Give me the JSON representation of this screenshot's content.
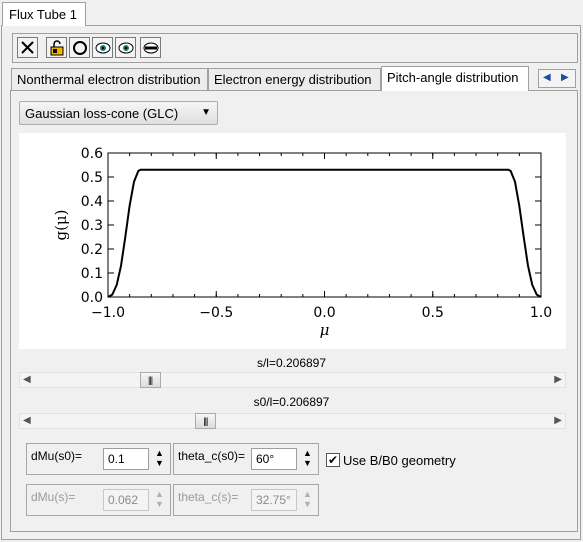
{
  "window": {
    "tab_title": "Flux Tube 1"
  },
  "toolbar": {
    "buttons": [
      {
        "icon": "close-x-icon"
      },
      {
        "icon": "lock-icon"
      },
      {
        "icon": "circle-icon"
      },
      {
        "icon": "eye-icon"
      },
      {
        "icon": "eye-icon"
      },
      {
        "icon": "eye-slash-icon"
      }
    ]
  },
  "tabs": [
    {
      "label": "Nonthermal electron distribution",
      "active": false
    },
    {
      "label": "Electron energy distribution",
      "active": false
    },
    {
      "label": "Pitch-angle distribution",
      "active": true
    }
  ],
  "distribution_select": {
    "value": "Gaussian loss-cone (GLC)"
  },
  "chart_data": {
    "type": "line",
    "xlabel": "μ",
    "ylabel": "g(μ)",
    "xlim": [
      -1.0,
      1.0
    ],
    "ylim": [
      0.0,
      0.6
    ],
    "xticks": [
      "−1.0",
      "−0.5",
      "0.0",
      "0.5",
      "1.0"
    ],
    "yticks": [
      "0.0",
      "0.1",
      "0.2",
      "0.3",
      "0.4",
      "0.5",
      "0.6"
    ],
    "series": [
      {
        "x": [
          -1.0,
          -0.98,
          -0.96,
          -0.94,
          -0.92,
          -0.9,
          -0.88,
          -0.86,
          -0.85,
          -0.5,
          0.0,
          0.5,
          0.85,
          0.86,
          0.88,
          0.9,
          0.92,
          0.94,
          0.96,
          0.98,
          1.0
        ],
        "y": [
          0.0,
          0.01,
          0.05,
          0.13,
          0.25,
          0.38,
          0.48,
          0.525,
          0.53,
          0.53,
          0.53,
          0.53,
          0.53,
          0.525,
          0.48,
          0.38,
          0.25,
          0.13,
          0.05,
          0.01,
          0.0
        ]
      }
    ]
  },
  "slider_s": {
    "label": "s/l=0.206897",
    "value": 0.206897
  },
  "slider_s0": {
    "label": "s0/l=0.206897",
    "value": 0.206897
  },
  "fields": {
    "dmu_s0": {
      "label": "dMu(s0)=",
      "value": "0.1"
    },
    "theta_c_s0": {
      "label": "theta_c(s0)=",
      "value": "60°"
    },
    "use_geometry": {
      "label": "Use B/B0 geometry",
      "checked": true
    },
    "dmu_s": {
      "label": "dMu(s)=",
      "value": "0.062"
    },
    "theta_c_s": {
      "label": "theta_c(s)=",
      "value": "32.75°"
    }
  }
}
